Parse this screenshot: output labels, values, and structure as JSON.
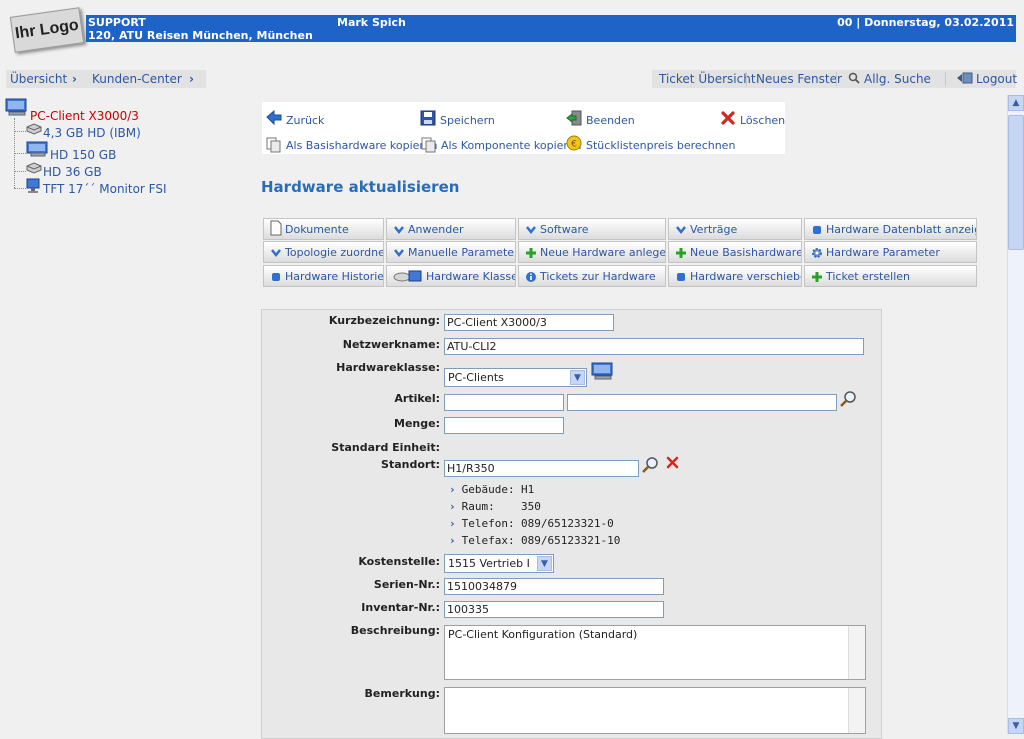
{
  "header": {
    "logo_text": "Ihr Logo",
    "line1_left": "SUPPORT",
    "line2_left": "120, ATU Reisen München, München",
    "user": "Mark Spich",
    "date_info": "00 | Donnerstag, 03.02.2011"
  },
  "breadcrumb": [
    "Übersicht",
    "Kunden-Center"
  ],
  "top_nav": {
    "ticket_overview": "Ticket Übersicht",
    "new_window": "Neues Fenster",
    "search": "Allg. Suche",
    "logout": "Logout"
  },
  "tree": {
    "root": "PC-Client X3000/3",
    "children": [
      "4,3 GB HD (IBM)",
      "HD 150 GB",
      "HD 36 GB",
      "TFT 17´´ Monitor FSI"
    ]
  },
  "toolbar": {
    "back": "Zurück",
    "save": "Speichern",
    "quit": "Beenden",
    "delete": "Löschen",
    "copy_base": "Als Basishardware kopieren",
    "copy_component": "Als Komponente kopieren",
    "calc_price": "Stücklistenpreis berechnen"
  },
  "page_title": "Hardware aktualisieren",
  "tabs": {
    "row1": [
      "Dokumente",
      "Anwender",
      "Software",
      "Verträge",
      "Hardware Datenblatt anzeigen"
    ],
    "row2": [
      "Topologie zuordnen",
      "Manuelle Parameter",
      "Neue Hardware anlegen",
      "Neue Basishardware",
      "Hardware Parameter"
    ],
    "row3": [
      "Hardware Historie",
      "Hardware Klassen",
      "Tickets zur Hardware",
      "Hardware verschieben",
      "Ticket erstellen"
    ]
  },
  "form": {
    "labels": {
      "kurz": "Kurzbezeichnung:",
      "netz": "Netzwerkname:",
      "klasse": "Hardwareklasse:",
      "artikel": "Artikel:",
      "menge": "Menge:",
      "einheit": "Standard Einheit:",
      "standort": "Standort:",
      "kosten": "Kostenstelle:",
      "serien": "Serien-Nr.:",
      "inventar": "Inventar-Nr.:",
      "beschreibung": "Beschreibung:",
      "bemerkung": "Bemerkung:"
    },
    "values": {
      "kurz": "PC-Client X3000/3",
      "netz": "ATU-CLI2",
      "klasse": "PC-Clients",
      "artikel1": "",
      "artikel2": "",
      "menge": "",
      "standort": "H1/R350",
      "kosten": "1515 Vertrieb I",
      "serien": "1510034879",
      "inventar": "100335",
      "beschreibung": "PC-Client Konfiguration (Standard)",
      "bemerkung": ""
    },
    "location_info": [
      {
        "label": "Gebäude:",
        "value": "H1"
      },
      {
        "label": "Raum:",
        "value": "350"
      },
      {
        "label": "Telefon:",
        "value": "089/65123321-0"
      },
      {
        "label": "Telefax:",
        "value": "089/65123321-10"
      }
    ]
  },
  "colors": {
    "header_bar": "#1e63c8",
    "link": "#2b57a6",
    "tree_selected": "#cc0000",
    "title": "#2b6cb8"
  }
}
